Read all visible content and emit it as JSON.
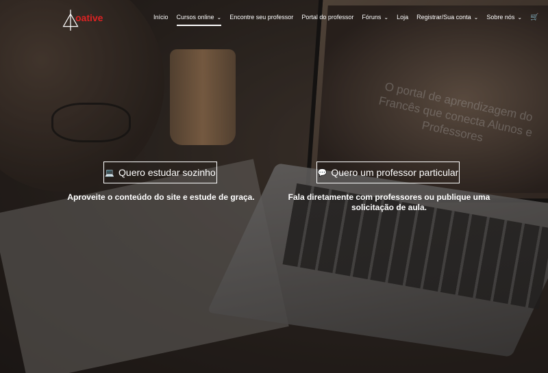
{
  "nav": {
    "logo_text": "oative",
    "items": [
      {
        "label": "Início",
        "dropdown": false
      },
      {
        "label": "Cursos online",
        "dropdown": true
      },
      {
        "label": "Encontre seu professor",
        "dropdown": false
      },
      {
        "label": "Portal do professor",
        "dropdown": false
      },
      {
        "label": "Fóruns",
        "dropdown": true
      },
      {
        "label": "Loja",
        "dropdown": false
      },
      {
        "label": "Registrar/Sua conta",
        "dropdown": true
      },
      {
        "label": "Sobre nós",
        "dropdown": true
      }
    ],
    "icons": [
      "cart-icon",
      "search-icon"
    ]
  },
  "hero": {
    "screen_text": "O portal de aprendizagem do Francês que conecta Alunos e Professores",
    "cta_self": {
      "label": "Quero estudar sozinho",
      "icon": "laptop-icon"
    },
    "cta_teacher": {
      "label": "Quero um professor particular",
      "icon": "chat-icon"
    },
    "desc_self": "Aproveite o conteúdo do site e estude de graça.",
    "desc_teacher": "Fala diretamente com professores ou publique uma solicitação de aula."
  }
}
